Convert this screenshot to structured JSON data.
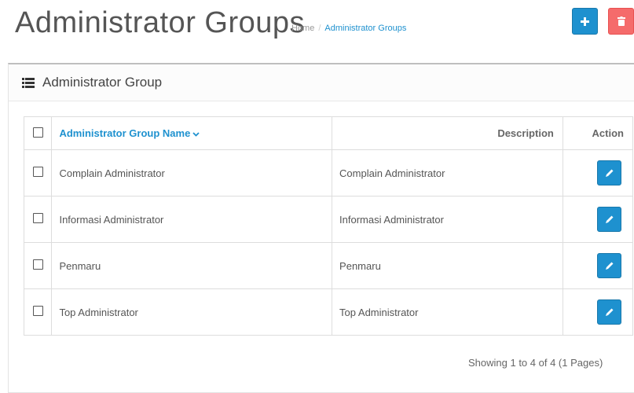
{
  "header": {
    "title": "Administrator Groups",
    "breadcrumb": {
      "home": "Home",
      "separator": "/",
      "current": "Administrator Groups"
    },
    "add_icon": "plus-icon",
    "delete_icon": "trash-icon"
  },
  "panel": {
    "icon": "list-icon",
    "title": "Administrator Group"
  },
  "table": {
    "columns": {
      "name": "Administrator Group Name",
      "description": "Description",
      "action": "Action"
    },
    "rows": [
      {
        "name": "Complain Administrator",
        "description": "Complain Administrator"
      },
      {
        "name": "Informasi Administrator",
        "description": "Informasi Administrator"
      },
      {
        "name": "Penmaru",
        "description": "Penmaru"
      },
      {
        "name": "Top Administrator",
        "description": "Top Administrator"
      }
    ]
  },
  "pagination": {
    "text": "Showing 1 to 4 of 4 (1 Pages)"
  },
  "colors": {
    "accent": "#1e91cf",
    "danger": "#f56b6b"
  }
}
